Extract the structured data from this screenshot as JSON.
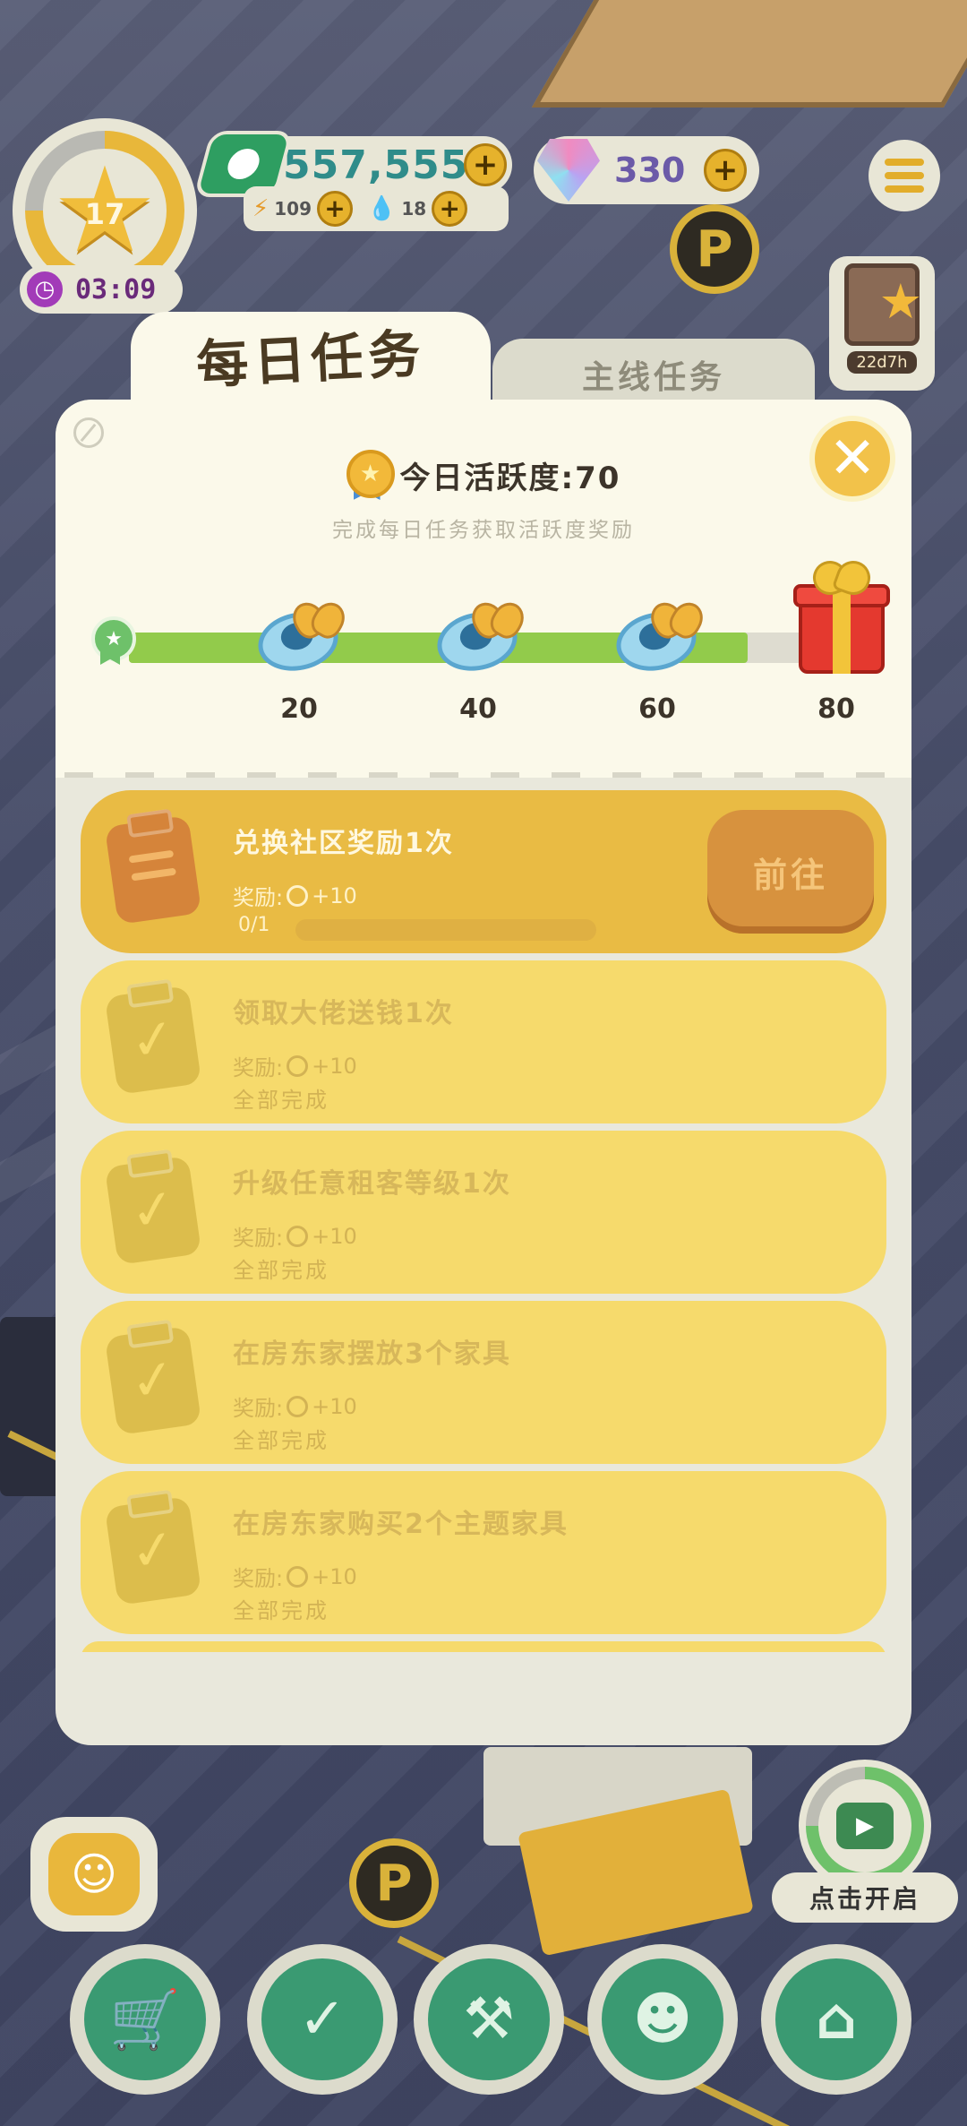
{
  "hud": {
    "level": "17",
    "timer": "03:09",
    "money": "557,555",
    "energy": "109",
    "water": "18",
    "gems": "330",
    "book_timer": "22d7h",
    "plus_label": "+"
  },
  "tabs": {
    "daily": "每日任务",
    "main": "主线任务"
  },
  "activity": {
    "title": "今日活跃度:70",
    "subtitle": "完成每日任务获取活跃度奖励",
    "value": 70,
    "max": 80,
    "milestones": [
      "20",
      "40",
      "60",
      "80"
    ]
  },
  "tasks": [
    {
      "title": "兑换社区奖励1次",
      "reward": "奖励:",
      "reward_value": "+10",
      "progress": "0/1",
      "button": "前往",
      "active": true
    },
    {
      "title": "领取大佬送钱1次",
      "reward": "奖励:",
      "reward_value": "+10",
      "status": "全部完成"
    },
    {
      "title": "升级任意租客等级1次",
      "reward": "奖励:",
      "reward_value": "+10",
      "status": "全部完成"
    },
    {
      "title": "在房东家摆放3个家具",
      "reward": "奖励:",
      "reward_value": "+10",
      "status": "全部完成"
    },
    {
      "title": "在房东家购买2个主题家具",
      "reward": "奖励:",
      "reward_value": "+10",
      "status": "全部完成"
    }
  ],
  "tv": {
    "label": "点击开启"
  },
  "colors": {
    "accent": "#e9bb44",
    "progress": "#92cb4b",
    "nav": "#3a9a72"
  }
}
